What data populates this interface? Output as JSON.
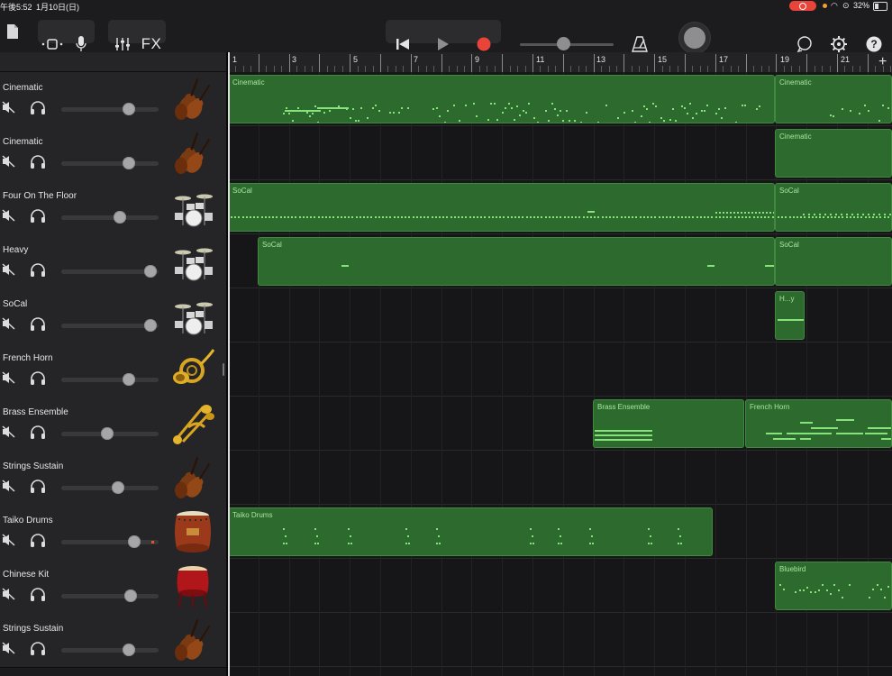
{
  "status_bar": {
    "time": "午後5:52",
    "date": "1月10日(日)",
    "battery": "32%",
    "battery_level": 0.32
  },
  "toolbar": {
    "fx_label": "FX",
    "tempo_position": 0.45
  },
  "ruler": {
    "bar_numbers": [
      "1",
      "3",
      "5",
      "7",
      "9",
      "11",
      "13",
      "15",
      "17",
      "19",
      "21"
    ]
  },
  "tracks": [
    {
      "name": "Cinematic",
      "instrument": "violin-icon",
      "volume": 0.68
    },
    {
      "name": "Cinematic",
      "instrument": "violin-icon",
      "volume": 0.68
    },
    {
      "name": "Four On The Floor",
      "instrument": "drum-kit-icon",
      "volume": 0.58
    },
    {
      "name": "Heavy",
      "instrument": "drum-kit-icon",
      "volume": 0.92
    },
    {
      "name": "SoCal",
      "instrument": "drum-kit-icon",
      "volume": 0.92
    },
    {
      "name": "French Horn",
      "instrument": "french-horn-icon",
      "volume": 0.68
    },
    {
      "name": "Brass Ensemble",
      "instrument": "brass-icon",
      "volume": 0.44
    },
    {
      "name": "Strings Sustain",
      "instrument": "violin-icon",
      "volume": 0.56
    },
    {
      "name": "Taiko Drums",
      "instrument": "taiko-drum-icon",
      "volume": 0.74
    },
    {
      "name": "Chinese Kit",
      "instrument": "chinese-drum-icon",
      "volume": 0.7
    },
    {
      "name": "Strings Sustain",
      "instrument": "violin-icon",
      "volume": 0.68
    }
  ],
  "regions": [
    {
      "track": 0,
      "name": "Cinematic"
    },
    {
      "track": 0,
      "name": "Cinematic"
    },
    {
      "track": 1,
      "name": "Cinematic"
    },
    {
      "track": 2,
      "name": "SoCal"
    },
    {
      "track": 2,
      "name": "SoCal"
    },
    {
      "track": 3,
      "name": "SoCal"
    },
    {
      "track": 3,
      "name": "SoCal"
    },
    {
      "track": 4,
      "name": "H...y"
    },
    {
      "track": 6,
      "name": "Brass Ensemble"
    },
    {
      "track": 6,
      "name": "French Horn"
    },
    {
      "track": 8,
      "name": "Taiko Drums"
    },
    {
      "track": 9,
      "name": "Bluebird"
    }
  ],
  "colors": {
    "region_fill": "#2d6a2d",
    "note": "#86e37c",
    "record": "#e8443a",
    "accent_level": "#e05a1e"
  }
}
